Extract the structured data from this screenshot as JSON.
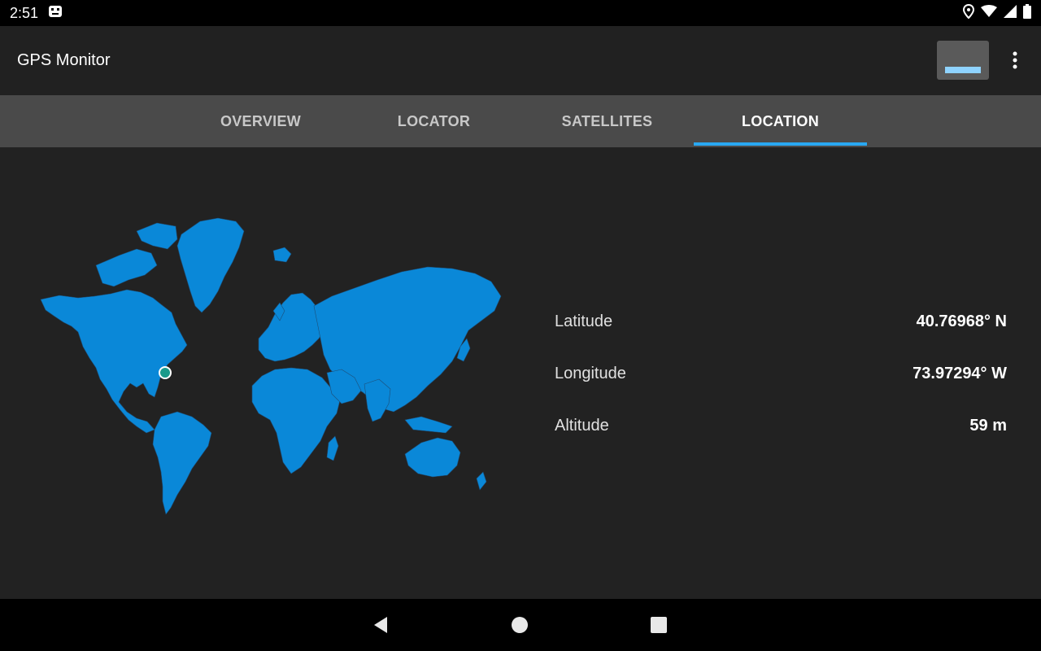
{
  "status_bar": {
    "time": "2:51",
    "icons": [
      "app-notification-icon",
      "location-icon",
      "wifi-icon",
      "signal-icon",
      "battery-icon"
    ]
  },
  "app_bar": {
    "title": "GPS Monitor",
    "icons": [
      "screen-toggle-icon",
      "more-vert-icon"
    ]
  },
  "tabs": [
    {
      "label": "OVERVIEW",
      "active": false
    },
    {
      "label": "LOCATOR",
      "active": false
    },
    {
      "label": "SATELLITES",
      "active": false
    },
    {
      "label": "LOCATION",
      "active": true
    }
  ],
  "location": {
    "latitude_label": "Latitude",
    "latitude_value": "40.76968° N",
    "longitude_label": "Longitude",
    "longitude_value": "73.97294° W",
    "altitude_label": "Altitude",
    "altitude_value": "59 m"
  },
  "map": {
    "land_color": "#0a88d8",
    "marker_color": "#1a9a8a"
  },
  "colors": {
    "accent": "#29a8f2",
    "background": "#222222",
    "tab_bar": "#4a4a4a"
  },
  "nav_bar": {
    "icons": [
      "back-icon",
      "home-icon",
      "recents-icon"
    ]
  }
}
